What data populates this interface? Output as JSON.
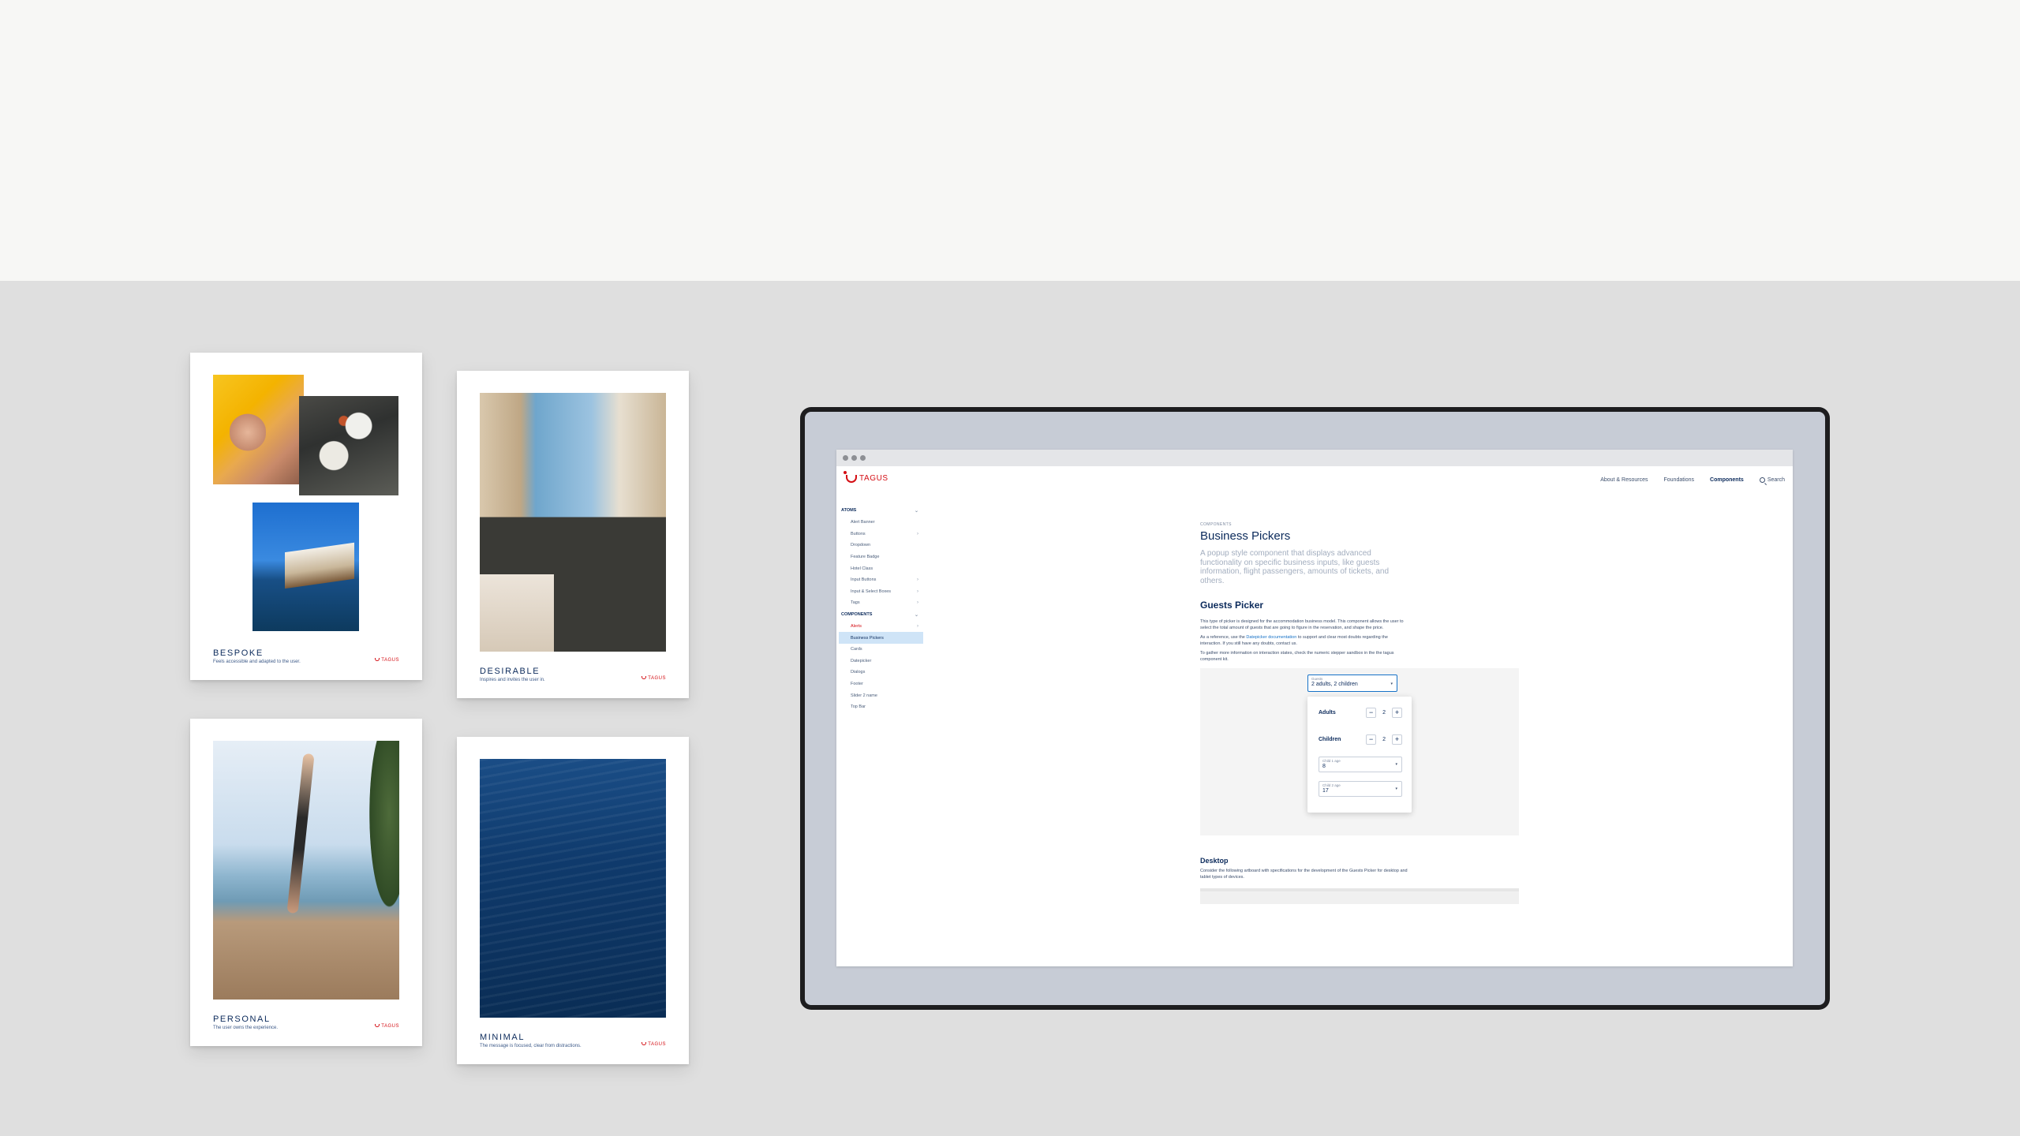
{
  "cards": [
    {
      "word": "BESPOKE",
      "tagline": "Feels accessible and adapted to the user.",
      "brand": "TAGUS"
    },
    {
      "word": "DESIRABLE",
      "tagline": "Inspires and invites the user in.",
      "brand": "TAGUS"
    },
    {
      "word": "PERSONAL",
      "tagline": "The user owns the experience.",
      "brand": "TAGUS"
    },
    {
      "word": "MINIMAL",
      "tagline": "The message is focused, clear from distractions.",
      "brand": "TAGUS"
    }
  ],
  "site": {
    "brand": "TAGUS",
    "nav": [
      "About & Resources",
      "Foundations",
      "Components"
    ],
    "active_nav": "Components",
    "search_label": "Search"
  },
  "sidebar": {
    "groups": [
      {
        "label": "ATOMS",
        "items": [
          {
            "label": "Alert Banner",
            "chevron": ""
          },
          {
            "label": "Buttons",
            "chevron": "›"
          },
          {
            "label": "Dropdown",
            "chevron": ""
          },
          {
            "label": "Feature Badge",
            "chevron": ""
          },
          {
            "label": "Hotel Class",
            "chevron": ""
          },
          {
            "label": "Input Buttons",
            "chevron": "›"
          },
          {
            "label": "Input & Select Boxes",
            "chevron": "›"
          },
          {
            "label": "Tags",
            "chevron": "›"
          }
        ]
      },
      {
        "label": "COMPONENTS",
        "items": [
          {
            "label": "Alerts",
            "chevron": "›"
          },
          {
            "label": "Business Pickers",
            "chevron": ""
          },
          {
            "label": "Cards",
            "chevron": ""
          },
          {
            "label": "Datepicker",
            "chevron": ""
          },
          {
            "label": "Dialogs",
            "chevron": ""
          },
          {
            "label": "Footer",
            "chevron": ""
          },
          {
            "label": "Slider 2 name",
            "chevron": ""
          },
          {
            "label": "Top Bar",
            "chevron": ""
          }
        ]
      }
    ],
    "group_chevron": "⌄"
  },
  "doc": {
    "eyebrow": "COMPONENTS",
    "title": "Business Pickers",
    "lead": "A popup style component that displays advanced functionality on specific business inputs, like guests information, flight passengers, amounts of tickets, and others.",
    "section_title": "Guests Picker",
    "p1": "This type of picker is designed for the accommodation business model. This component allows the user to select the total amount of guests that are going to figure in the reservation, and shape the price.",
    "p2_before": "As a reference, use the ",
    "p2_link": "Datepicker documentation",
    "p2_after": " to support and clear most doubts regarding the interaction. If you still have any doubts, contact us.",
    "p3": "To gather more information on interaction states, check the numeric stepper sandbox in the the tagus component kit.",
    "desktop_title": "Desktop",
    "desktop_text": "Consider the following artboard with specifications for the development of the Guests Picker for desktop and tablet types of devices."
  },
  "picker": {
    "field_label": "Guests",
    "field_value": "2 adults, 2 children",
    "caret": "▾",
    "minus": "−",
    "plus": "+",
    "adults_label": "Adults",
    "adults_value": "2",
    "children_label": "Children",
    "children_value": "2",
    "child_ages": [
      {
        "label": "Child 1 age",
        "value": "8"
      },
      {
        "label": "Child 2 age",
        "value": "17"
      }
    ]
  },
  "colors": {
    "brand_red": "#d40e14",
    "navy": "#0b2a5b",
    "link_blue": "#1772c7",
    "selected_bg": "#cfe4f7"
  }
}
